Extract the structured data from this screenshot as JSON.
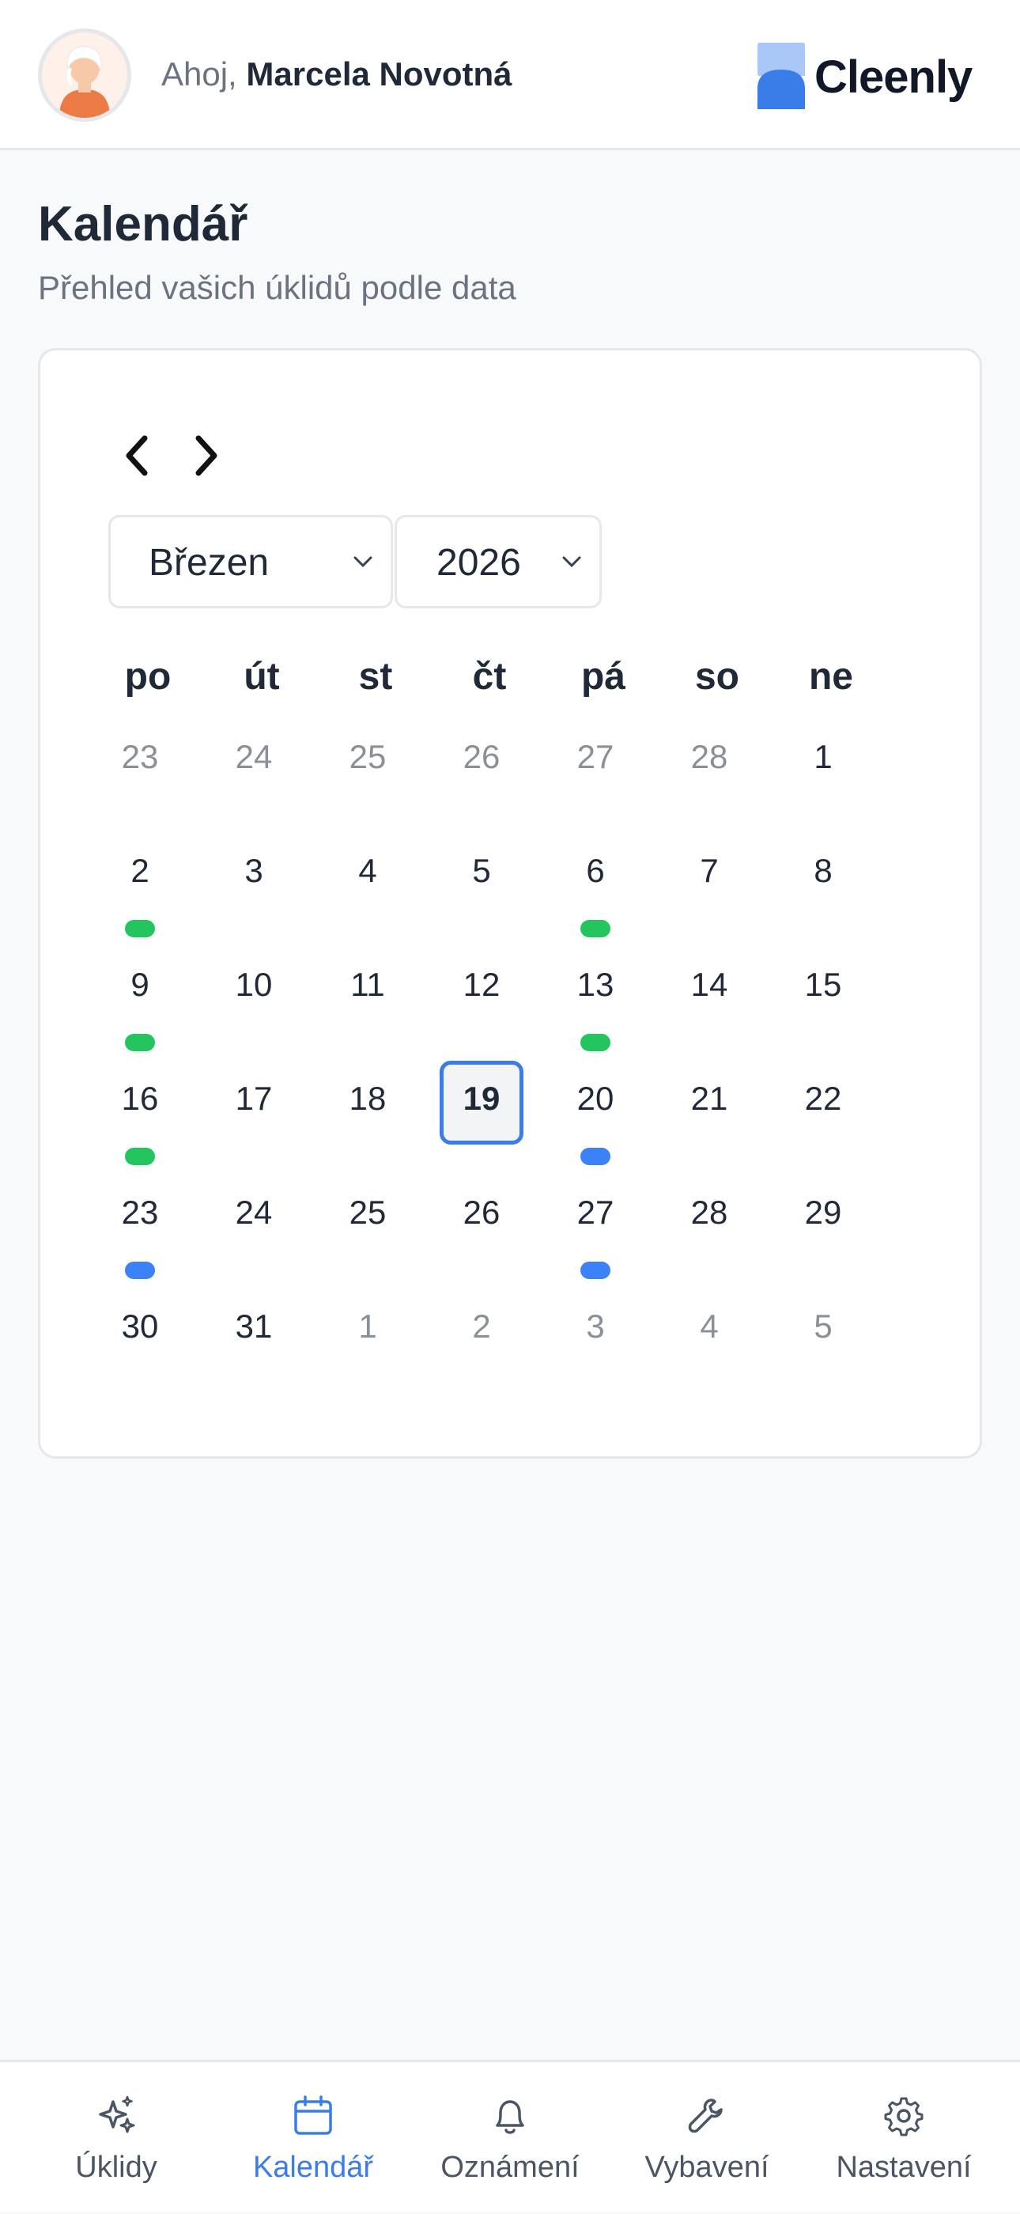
{
  "header": {
    "greeting": "Ahoj,",
    "user_name": "Marcela Novotná",
    "brand": "Cleenly"
  },
  "page": {
    "title": "Kalendář",
    "subtitle": "Přehled vašich úklidů podle data"
  },
  "calendar": {
    "month": "Březen",
    "year": "2026",
    "weekdays": [
      "po",
      "út",
      "st",
      "čt",
      "pá",
      "so",
      "ne"
    ],
    "today": "19",
    "weeks": [
      [
        {
          "d": "23",
          "m": true
        },
        {
          "d": "24",
          "m": true
        },
        {
          "d": "25",
          "m": true
        },
        {
          "d": "26",
          "m": true
        },
        {
          "d": "27",
          "m": true
        },
        {
          "d": "28",
          "m": true
        },
        {
          "d": "1"
        }
      ],
      [
        {
          "d": "2",
          "dot": "green"
        },
        {
          "d": "3"
        },
        {
          "d": "4"
        },
        {
          "d": "5"
        },
        {
          "d": "6",
          "dot": "green"
        },
        {
          "d": "7"
        },
        {
          "d": "8"
        }
      ],
      [
        {
          "d": "9",
          "dot": "green"
        },
        {
          "d": "10"
        },
        {
          "d": "11"
        },
        {
          "d": "12"
        },
        {
          "d": "13",
          "dot": "green"
        },
        {
          "d": "14"
        },
        {
          "d": "15"
        }
      ],
      [
        {
          "d": "16",
          "dot": "green"
        },
        {
          "d": "17"
        },
        {
          "d": "18"
        },
        {
          "d": "19",
          "today": true
        },
        {
          "d": "20",
          "dot": "blue"
        },
        {
          "d": "21"
        },
        {
          "d": "22"
        }
      ],
      [
        {
          "d": "23",
          "dot": "blue"
        },
        {
          "d": "24"
        },
        {
          "d": "25"
        },
        {
          "d": "26"
        },
        {
          "d": "27",
          "dot": "blue"
        },
        {
          "d": "28"
        },
        {
          "d": "29"
        }
      ],
      [
        {
          "d": "30"
        },
        {
          "d": "31"
        },
        {
          "d": "1",
          "m": true
        },
        {
          "d": "2",
          "m": true
        },
        {
          "d": "3",
          "m": true
        },
        {
          "d": "4",
          "m": true
        },
        {
          "d": "5",
          "m": true
        }
      ]
    ]
  },
  "colors": {
    "accent": "#3b7de8",
    "green_dot": "#22c55e",
    "blue_dot": "#3b82f6"
  },
  "nav": [
    {
      "label": "Úklidy",
      "icon": "sparkles-icon",
      "active": false
    },
    {
      "label": "Kalendář",
      "icon": "calendar-icon",
      "active": true
    },
    {
      "label": "Oznámení",
      "icon": "bell-icon",
      "active": false
    },
    {
      "label": "Vybavení",
      "icon": "wrench-icon",
      "active": false
    },
    {
      "label": "Nastavení",
      "icon": "gear-icon",
      "active": false
    }
  ]
}
